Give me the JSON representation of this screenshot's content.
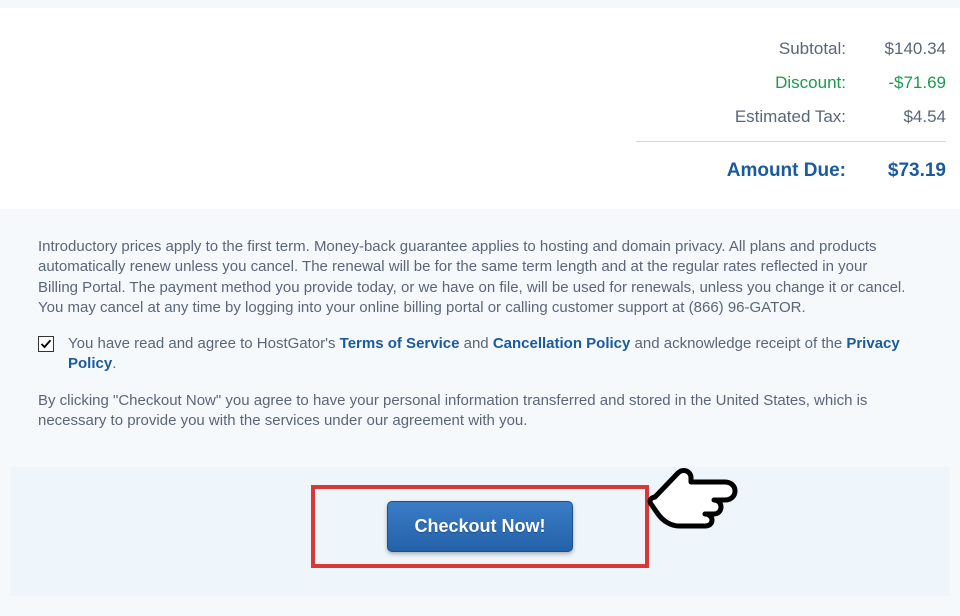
{
  "summary": {
    "subtotal_label": "Subtotal:",
    "subtotal_value": "$140.34",
    "discount_label": "Discount:",
    "discount_value": "-$71.69",
    "tax_label": "Estimated Tax:",
    "tax_value": "$4.54",
    "due_label": "Amount Due:",
    "due_value": "$73.19"
  },
  "terms": {
    "intro_text": "Introductory prices apply to the first term. Money-back guarantee applies to hosting and domain privacy. All plans and products automatically renew unless you cancel. The renewal will be for the same term length and at the regular rates reflected in your Billing Portal. The payment method you provide today, or we have on file, will be used for renewals, unless you change it or cancel. You may cancel at any time by logging into your online billing portal or calling customer support at (866) 96-GATOR.",
    "agree_prefix": "You have read and agree to HostGator's ",
    "tos_link": "Terms of Service",
    "and_text": " and ",
    "cancellation_link": "Cancellation Policy",
    "acknowledge_text": " and acknowledge receipt of the ",
    "privacy_link": "Privacy Policy",
    "period": ".",
    "transfer_text": "By clicking \"Checkout Now\" you agree to have your personal information transferred and stored in the United States, which is necessary to provide you with the services under our agreement with you."
  },
  "checkout": {
    "button_label": "Checkout Now!"
  }
}
